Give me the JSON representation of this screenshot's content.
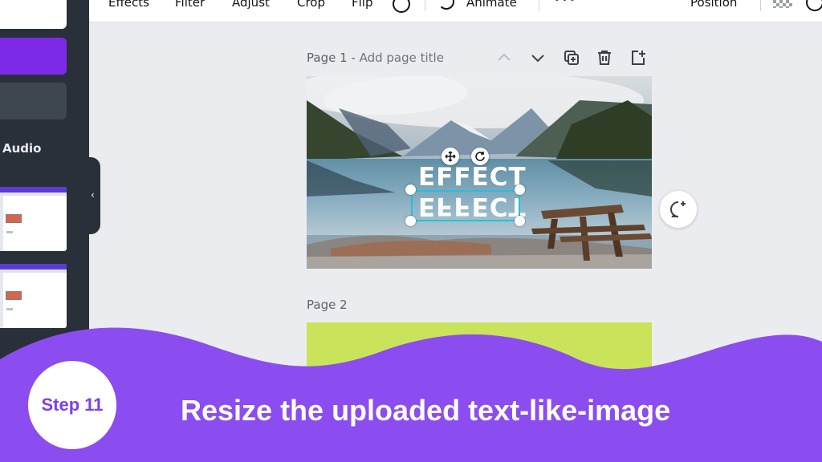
{
  "toolbar": {
    "items": [
      "Effects",
      "Filter",
      "Adjust",
      "Crop",
      "Flip"
    ],
    "animate_label": "Animate",
    "more_label": "•••",
    "position_label": "Position"
  },
  "sidebar": {
    "audio_label": "Audio"
  },
  "canvas": {
    "page1_label": "Page 1 - ",
    "page1_title_placeholder": "Add page title",
    "page2_label": "Page 2",
    "text_effect": "EFFECT",
    "text_effect_mirrored": "EFFECT"
  },
  "banner": {
    "step_label": "Step 11",
    "instruction": "Resize the uploaded text-like-image"
  },
  "colors": {
    "brand_purple": "#7d2ae8",
    "banner_purple": "#8b4df0",
    "selection_cyan": "#22c2d8",
    "sidebar_dark": "#293039",
    "page2_green": "#c9e35a"
  }
}
